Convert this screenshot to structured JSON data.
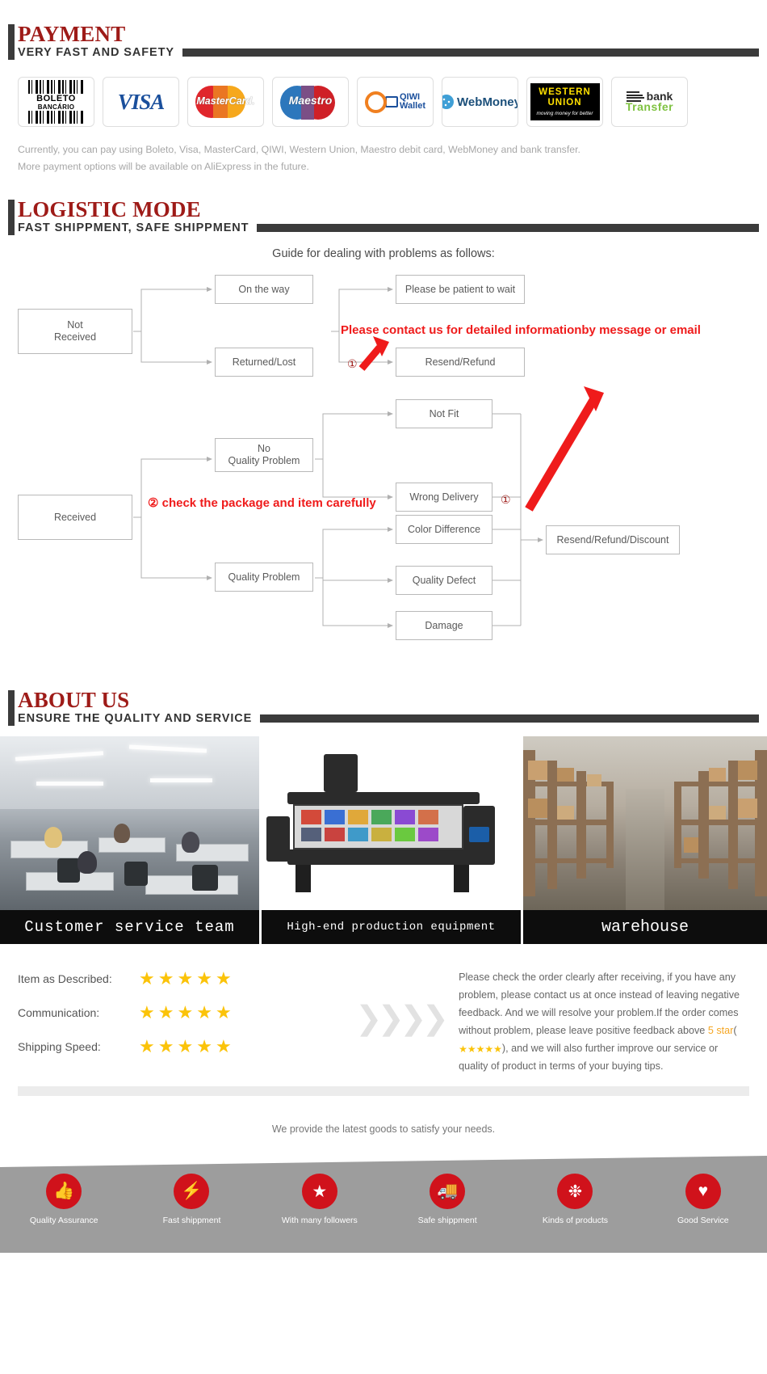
{
  "payment": {
    "title": "PAYMENT",
    "subtitle": "VERY FAST AND SAFETY",
    "methods": [
      {
        "name": "boleto-bancario-logo",
        "line1": "BOLETO",
        "line2": "BANCÁRIO"
      },
      {
        "name": "visa-logo",
        "label": "VISA"
      },
      {
        "name": "mastercard-logo",
        "label": "MasterCard."
      },
      {
        "name": "maestro-logo",
        "label": "Maestro"
      },
      {
        "name": "qiwi-wallet-logo",
        "line1": "QIWI",
        "line2": "Wallet"
      },
      {
        "name": "webmoney-logo",
        "label": "WebMoney"
      },
      {
        "name": "western-union-logo",
        "line1": "WESTERN",
        "line2": "UNION",
        "line3": "moving money for better"
      },
      {
        "name": "bank-transfer-logo",
        "line1": "bank",
        "line2": "Transfer"
      }
    ],
    "note_line1": "Currently, you can pay using Boleto, Visa, MasterCard, QIWI, Western Union, Maestro debit card, WebMoney and bank transfer.",
    "note_line2": "More payment options will be available on AliExpress in the future."
  },
  "logistic": {
    "title": "LOGISTIC MODE",
    "subtitle": "FAST SHIPPMENT, SAFE SHIPPMENT",
    "guide_title": "Guide for dealing with problems as follows:",
    "boxes": {
      "not_received": "Not\nReceived",
      "on_the_way": "On the way",
      "returned_lost": "Returned/Lost",
      "please_wait": "Please be patient to wait",
      "resend_refund": "Resend/Refund",
      "received": "Received",
      "no_quality_problem": "No\nQuality Problem",
      "quality_problem": "Quality Problem",
      "not_fit": "Not Fit",
      "wrong_delivery": "Wrong Delivery",
      "color_difference": "Color Difference",
      "quality_defect": "Quality Defect",
      "damage": "Damage",
      "resend_refund_discount": "Resend/Refund/Discount"
    },
    "red_note_1": "Please contact us for detailed informationby message or email",
    "red_note_2": "② check the package and item carefully",
    "marker_1": "①",
    "marker_2": "①"
  },
  "about": {
    "title": "ABOUT US",
    "subtitle": "ENSURE THE QUALITY AND SERVICE",
    "photos": [
      {
        "name": "photo-customer-service-team",
        "caption": "Customer service team"
      },
      {
        "name": "photo-production-equipment",
        "caption": "High-end production equipment"
      },
      {
        "name": "photo-warehouse",
        "caption": "warehouse"
      }
    ]
  },
  "feedback": {
    "ratings": [
      {
        "label": "Item as Described:",
        "stars": 5
      },
      {
        "label": "Communication:",
        "stars": 5
      },
      {
        "label": "Shipping Speed:",
        "stars": 5
      }
    ],
    "chevrons": "❯❯❯❯",
    "text_part1": "Please check the order clearly after receiving, if you have any problem, please contact us at once instead of leaving negative feedback. And we will resolve your problem.If the order comes without problem, please leave positive feedback above ",
    "text_highlight": "5 star",
    "text_paren_open": "(",
    "inline_stars": 5,
    "text_part2": "), and we will also further improve our service or quality of product in terms of your buying tips.",
    "star_glyph": "★"
  },
  "tagline": "We provide the latest goods to satisfy your needs.",
  "services": [
    {
      "name": "quality-assurance-icon",
      "glyph": "👍",
      "label": "Quality Assurance"
    },
    {
      "name": "fast-shipment-icon",
      "glyph": "⚡",
      "label": "Fast shippment"
    },
    {
      "name": "many-followers-icon",
      "glyph": "★",
      "label": "With many followers"
    },
    {
      "name": "safe-shipment-icon",
      "glyph": "🚚",
      "label": "Safe shippment"
    },
    {
      "name": "kinds-of-products-icon",
      "glyph": "❉",
      "label": "Kinds of products"
    },
    {
      "name": "good-service-icon",
      "glyph": "♥",
      "label": "Good Service"
    }
  ],
  "colors": {
    "heading_red": "#9e1b18",
    "accent_red": "#ef1b1b",
    "icon_red": "#d0121b",
    "star_yellow": "#fbc309",
    "bar_dark": "#3b3b3b"
  }
}
